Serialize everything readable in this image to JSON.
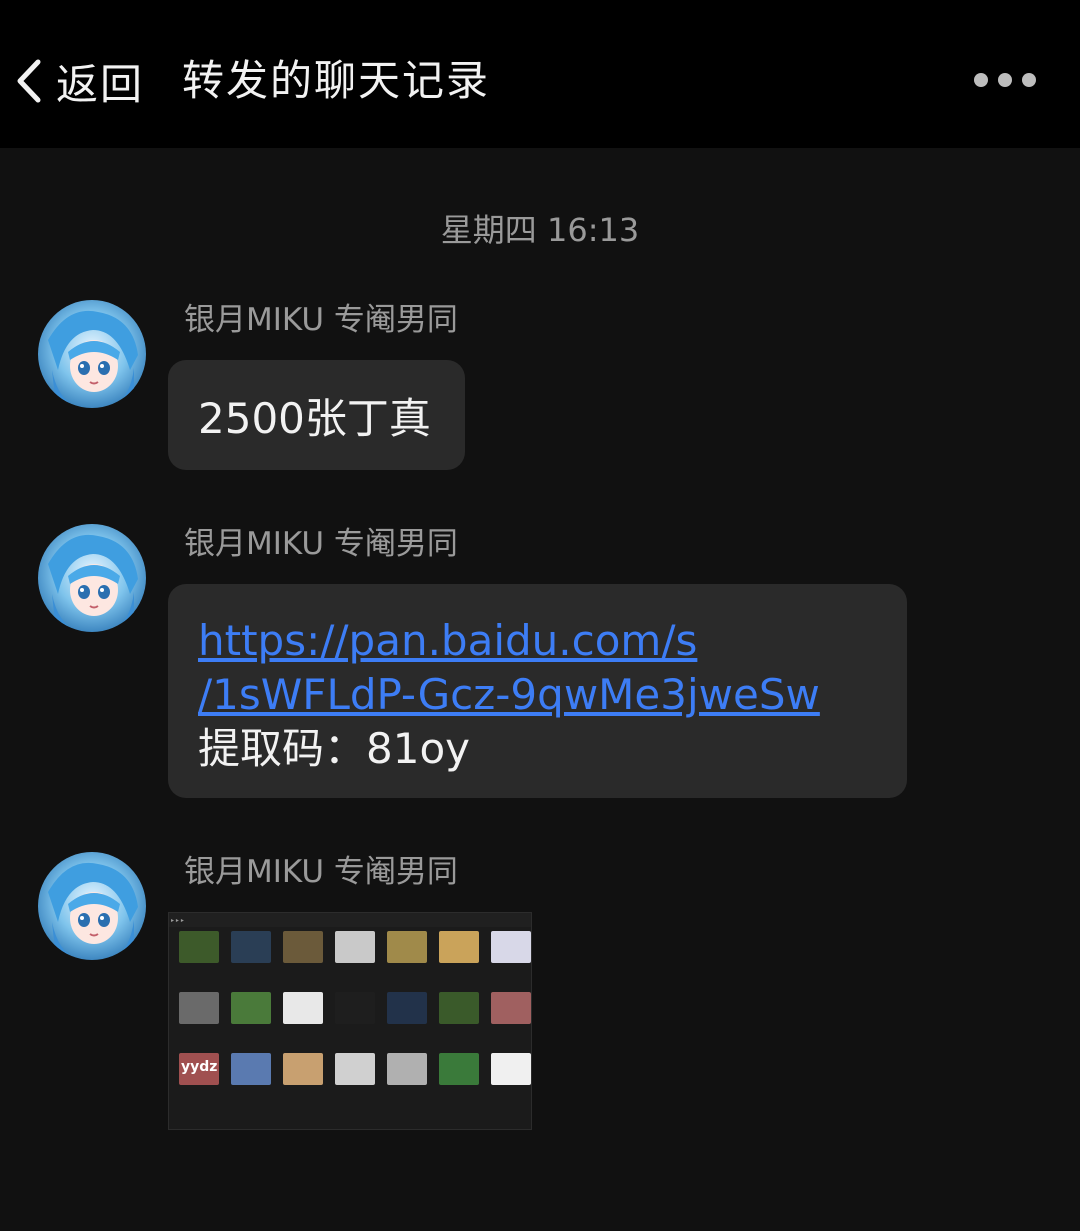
{
  "header": {
    "back_label": "返回",
    "title": "转发的聊天记录",
    "more_icon": "more-dots-icon"
  },
  "timestamp": "星期四 16:13",
  "messages": [
    {
      "sender": "银月MIKU 专阉男同",
      "text": "2500张丁真"
    },
    {
      "sender": "银月MIKU 专阉男同",
      "link_line1": "https://pan.baidu.com/s",
      "link_line2": "/1sWFLdP-Gcz-9qwMe3jweSw",
      "code": "提取码：81oy"
    },
    {
      "sender": "银月MIKU 专阉男同",
      "image_caption": "yydz"
    }
  ],
  "colors": {
    "background": "#111111",
    "header": "#000000",
    "bubble": "#2a2a2a",
    "link": "#3d7df5",
    "muted": "#9a9a9a"
  }
}
